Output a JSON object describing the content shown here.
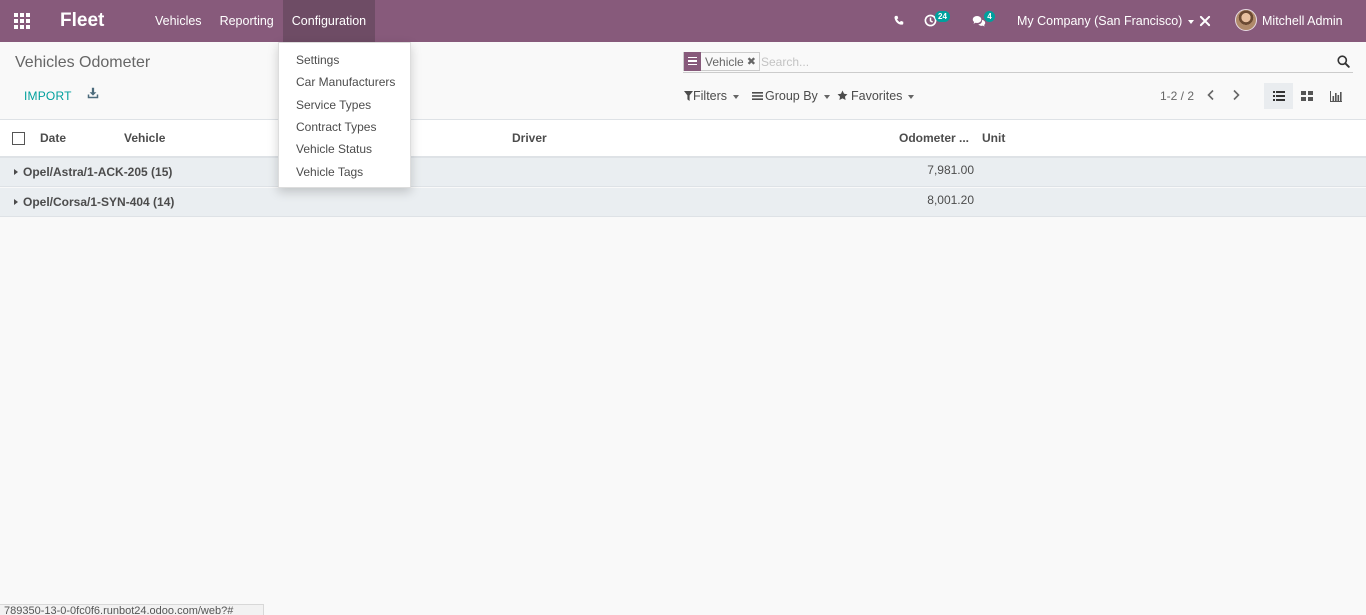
{
  "navbar": {
    "brand": "Fleet",
    "menu": [
      {
        "label": "Vehicles"
      },
      {
        "label": "Reporting"
      },
      {
        "label": "Configuration",
        "active": true
      }
    ],
    "activity_count": "24",
    "message_count": "4",
    "company": "My Company (San Francisco)",
    "user": "Mitchell Admin",
    "bg_color": "#875a7b"
  },
  "config_menu": {
    "items": [
      "Settings",
      "Car Manufacturers",
      "Service Types",
      "Contract Types",
      "Vehicle Status",
      "Vehicle Tags"
    ]
  },
  "control_panel": {
    "title": "Vehicles Odometer",
    "import_label": "IMPORT",
    "search_facet": "Vehicle",
    "search_placeholder": "Search...",
    "filters_label": "Filters",
    "groupby_label": "Group By",
    "favorites_label": "Favorites",
    "pager": "1-2 / 2",
    "accent_color": "#00a09d"
  },
  "table": {
    "columns": [
      "Date",
      "Vehicle",
      "Driver",
      "Odometer ...",
      "Unit"
    ],
    "groups": [
      {
        "label": "Opel/Astra/1-ACK-205 (15)",
        "value": "7,981.00"
      },
      {
        "label": "Opel/Corsa/1-SYN-404 (14)",
        "value": "8,001.20"
      }
    ]
  },
  "status_bar": {
    "url": "789350-13-0-0fc0f6.runbot24.odoo.com/web?#"
  }
}
